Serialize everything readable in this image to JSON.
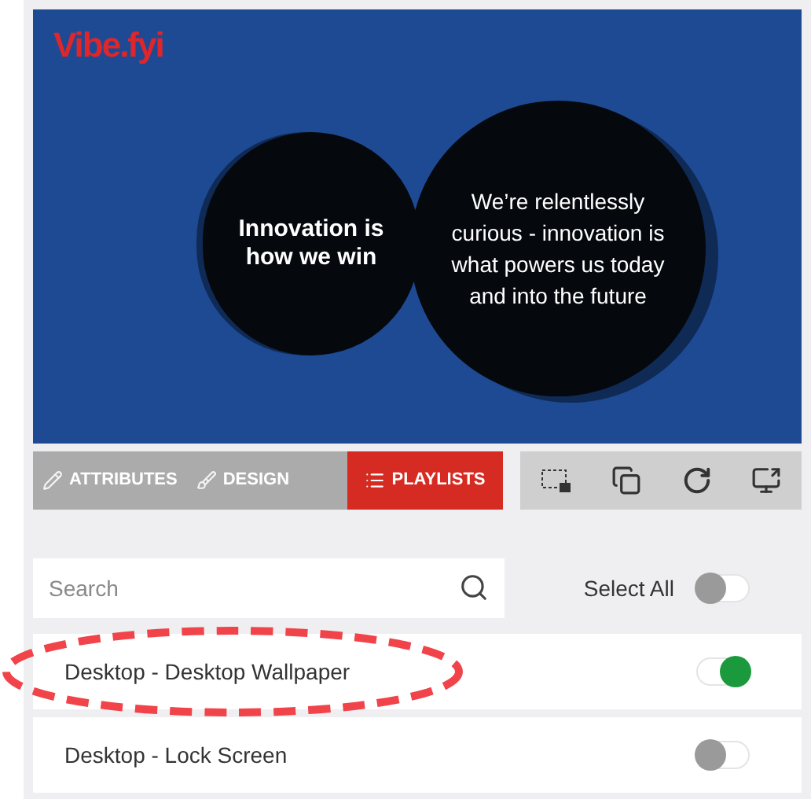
{
  "preview": {
    "logo": "Vibe.fyi",
    "left_circle": "Innovation is how we win",
    "right_circle": "We’re relentlessly curious - innovation is what powers us today and into the future"
  },
  "tabs": [
    {
      "label": "ATTRIBUTES",
      "kind": "edit",
      "selected": false
    },
    {
      "label": "DESIGN",
      "kind": "brush",
      "selected": false
    },
    {
      "label": "PLAYLISTS",
      "kind": "list",
      "selected": true
    }
  ],
  "search": {
    "placeholder": "Search"
  },
  "select_all": {
    "label": "Select All",
    "on": false
  },
  "playlists": [
    {
      "name": "Desktop - Desktop Wallpaper",
      "on": true,
      "highlighted": true
    },
    {
      "name": "Desktop - Lock Screen",
      "on": false,
      "highlighted": false
    }
  ]
}
